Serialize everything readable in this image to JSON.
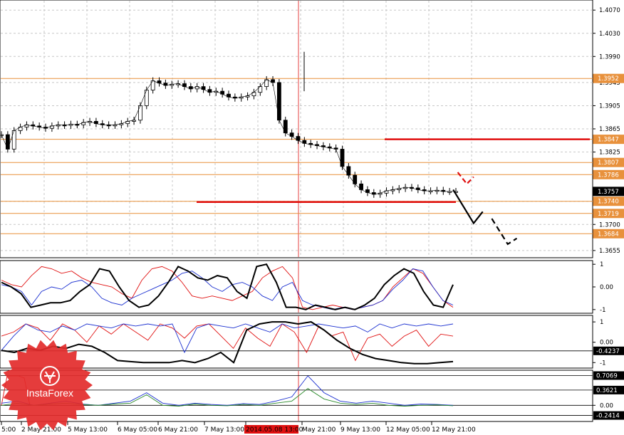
{
  "colors": {
    "level": "#e8913c",
    "red": "#e01010",
    "blue": "#1a2fd0",
    "purple": "#8a2a9a",
    "green": "#2a8a2a",
    "black": "#000000",
    "grid": "#c8c8c8",
    "current_tag": "#000000",
    "brand": "#e32b2b"
  },
  "brand": {
    "name": "InstaForex",
    "icon": "instaforex-logo-icon"
  },
  "chart_data": [
    {
      "type": "candlestick",
      "panel": "price",
      "ylim": [
        1.3645,
        1.4085
      ],
      "y_ticks": [
        "1.4070",
        "1.4030",
        "1.3990",
        "1.3945",
        "1.3905",
        "1.3865",
        "1.3825",
        "1.3740",
        "1.3700",
        "1.3655"
      ],
      "levels": [
        {
          "value": 1.3952,
          "label": "1.3952"
        },
        {
          "value": 1.3847,
          "label": "1.3847"
        },
        {
          "value": 1.3807,
          "label": "1.3807"
        },
        {
          "value": 1.3786,
          "label": "1.3786"
        },
        {
          "value": 1.374,
          "label": "1.3740"
        },
        {
          "value": 1.3719,
          "label": "1.3719"
        },
        {
          "value": 1.3684,
          "label": "1.3684"
        }
      ],
      "current_price": {
        "value": 1.3757,
        "label": "1.3757"
      },
      "marked_time": "2014.05.08 13:00",
      "x_labels": [
        "5:00",
        "2 May 21:00",
        "5 May 13:00",
        "6 May 05:00",
        "6 May 21:00",
        "7 May 13:00",
        "2014.05.08 13:00",
        "May 21:00",
        "9 May 13:00",
        "12 May 05:00",
        "12 May 21:00"
      ],
      "x_label_positions": [
        0,
        1,
        2,
        3,
        4,
        5,
        6,
        7,
        8,
        9,
        10
      ],
      "resistance_line": {
        "value": 1.3847,
        "from_index": 3,
        "to_index": 14
      },
      "support_line": {
        "value": 1.374,
        "from_index": 4,
        "to_index": 9
      },
      "close_path": [
        1.3855,
        1.383,
        1.3862,
        1.3868,
        1.3872,
        1.387,
        1.3868,
        1.3866,
        1.387,
        1.3872,
        1.3871,
        1.3873,
        1.3872,
        1.3876,
        1.3878,
        1.3874,
        1.3872,
        1.3871,
        1.3872,
        1.3874,
        1.3878,
        1.388,
        1.3905,
        1.3932,
        1.3948,
        1.3944,
        1.394,
        1.3942,
        1.3943,
        1.3938,
        1.3934,
        1.3938,
        1.3933,
        1.3928,
        1.393,
        1.3925,
        1.392,
        1.3918,
        1.392,
        1.3922,
        1.3928,
        1.3938,
        1.395,
        1.3945,
        1.388,
        1.3858,
        1.3852,
        1.3845,
        1.384,
        1.3838,
        1.3836,
        1.3834,
        1.3832,
        1.383,
        1.38,
        1.3785,
        1.377,
        1.376,
        1.3755,
        1.3752,
        1.3754,
        1.3758,
        1.376,
        1.3762,
        1.3764,
        1.3763,
        1.376,
        1.3758,
        1.3758,
        1.3759,
        1.3757,
        1.3757,
        1.3757
      ],
      "forecast": {
        "black_path": [
          [
            0.9,
            1.376
          ],
          [
            0.945,
            1.3702
          ],
          [
            0.965,
            1.3722
          ]
        ],
        "black_dashed": [
          [
            0.985,
            1.371
          ],
          [
            1.02,
            1.3666
          ],
          [
            1.04,
            1.3676
          ]
        ],
        "red_dashed": [
          [
            0.91,
            1.379
          ],
          [
            0.93,
            1.377
          ],
          [
            0.945,
            1.3782
          ]
        ]
      }
    },
    {
      "type": "line",
      "panel": "oscillator_1",
      "ylim": [
        -1.1,
        1.1
      ],
      "y_ticks": [
        "1",
        "0.00",
        "-1"
      ],
      "series": [
        {
          "color_key": "red",
          "values": [
            0.3,
            0.1,
            0.0,
            0.5,
            0.9,
            0.8,
            0.6,
            0.7,
            0.4,
            0.2,
            0.1,
            0.0,
            -0.3,
            -0.5,
            0.3,
            0.8,
            0.9,
            0.7,
            0.2,
            -0.4,
            -0.5,
            -0.4,
            -0.5,
            -0.6,
            -0.4,
            -0.2,
            0.4,
            0.7,
            0.9,
            0.4,
            -0.9,
            -1.0,
            -0.9,
            -0.8,
            -0.9,
            -1.0,
            -0.9,
            -0.8,
            -0.6,
            0.0,
            0.4,
            0.8,
            0.6,
            0.0,
            -0.6,
            -0.9
          ]
        },
        {
          "color_key": "blue",
          "values": [
            0.1,
            0.0,
            -0.2,
            -0.8,
            -0.2,
            0.0,
            -0.1,
            0.2,
            0.3,
            0.0,
            -0.5,
            -0.7,
            -0.8,
            -0.5,
            -0.3,
            -0.1,
            0.1,
            0.3,
            0.6,
            0.7,
            0.4,
            0.0,
            -0.2,
            0.1,
            0.2,
            0.0,
            -0.4,
            -0.6,
            0.0,
            0.2,
            -0.6,
            -0.8,
            -0.9,
            -1.0,
            -0.9,
            -1.0,
            -0.9,
            -0.8,
            -0.6,
            -0.1,
            0.3,
            0.8,
            0.7,
            0.0,
            -0.6,
            -0.8
          ]
        },
        {
          "color_key": "black",
          "values": [
            0.2,
            0.0,
            -0.3,
            -0.9,
            -0.8,
            -0.7,
            -0.7,
            -0.6,
            -0.2,
            0.1,
            0.8,
            0.7,
            0.0,
            -0.6,
            -0.9,
            -0.8,
            -0.4,
            0.2,
            0.9,
            0.7,
            0.4,
            0.3,
            0.5,
            0.4,
            -0.2,
            -0.5,
            0.9,
            1.0,
            0.2,
            -0.9,
            -0.9,
            -1.0,
            -0.8,
            -0.9,
            -1.0,
            -0.9,
            -1.0,
            -0.8,
            -0.5,
            0.1,
            0.5,
            0.8,
            0.6,
            -0.2,
            -0.8,
            -0.9,
            0.1
          ]
        }
      ]
    },
    {
      "type": "line",
      "panel": "oscillator_2",
      "ylim": [
        -1.2,
        1.25
      ],
      "y_ticks": [
        "1",
        "0.00",
        "-1"
      ],
      "levels": [
        {
          "value": -0.4237,
          "label": "-0.4237"
        }
      ],
      "series": [
        {
          "color_key": "red",
          "values": [
            0.3,
            0.5,
            0.9,
            0.7,
            0.1,
            0.9,
            0.6,
            0.0,
            0.8,
            0.4,
            0.9,
            0.5,
            0.1,
            0.9,
            0.7,
            0.2,
            0.8,
            0.9,
            0.3,
            -0.3,
            0.7,
            0.2,
            -0.2,
            0.9,
            0.5,
            -0.5,
            0.8,
            0.3,
            0.5,
            -0.9,
            0.2,
            0.4,
            -0.2,
            0.3,
            0.6,
            -0.2,
            0.4,
            0.3
          ]
        },
        {
          "color_key": "blue",
          "values": [
            -0.4,
            0.3,
            0.9,
            0.6,
            0.5,
            0.8,
            0.6,
            0.9,
            0.8,
            0.7,
            0.9,
            0.8,
            0.9,
            0.8,
            0.9,
            -0.5,
            0.7,
            0.9,
            0.8,
            0.7,
            0.9,
            0.7,
            0.5,
            0.9,
            0.7,
            0.8,
            0.9,
            0.8,
            0.7,
            0.8,
            0.5,
            0.9,
            0.7,
            0.9,
            0.8,
            0.9,
            0.8,
            0.9
          ]
        },
        {
          "color_key": "black",
          "values": [
            -0.4,
            -0.5,
            -0.3,
            -0.4,
            -0.2,
            -0.3,
            -0.1,
            -0.2,
            -0.5,
            -0.9,
            -0.95,
            -1.0,
            -1.0,
            -1.0,
            -0.9,
            -1.0,
            -0.8,
            -0.5,
            -1.0,
            0.6,
            0.9,
            1.0,
            1.0,
            0.9,
            1.0,
            0.6,
            0.1,
            -0.3,
            -0.6,
            -0.8,
            -0.9,
            -1.0,
            -1.05,
            -1.05,
            -1.0,
            -0.95
          ]
        }
      ]
    },
    {
      "type": "line",
      "panel": "oscillator_3",
      "ylim": [
        -0.35,
        0.8
      ],
      "y_ticks": [
        "0.00"
      ],
      "levels": [
        {
          "value": 0.7069,
          "label": "0.7069"
        },
        {
          "value": 0.3621,
          "label": "0.3621"
        },
        {
          "value": 0.0,
          "label": "0.00"
        },
        {
          "value": -0.2414,
          "label": "-0.2414"
        }
      ],
      "series": [
        {
          "color_key": "red",
          "values": [
            0.0,
            0.7,
            0.7,
            0.7,
            0.65,
            0.0
          ]
        },
        {
          "color_key": "blue",
          "values": [
            0.05,
            0.1,
            0.0,
            0.05,
            0.1,
            0.03,
            0.0,
            0.05,
            0.1,
            0.3,
            0.05,
            0.0,
            0.05,
            0.02,
            0.0,
            0.04,
            0.02,
            0.1,
            0.2,
            0.7,
            0.3,
            0.1,
            0.05,
            0.1,
            0.05,
            0.0,
            0.03,
            0.02,
            0.0
          ]
        },
        {
          "color_key": "green",
          "values": [
            0.0,
            0.05,
            0.0,
            0.03,
            0.05,
            0.02,
            0.0,
            0.03,
            0.05,
            0.25,
            0.0,
            -0.02,
            0.03,
            0.0,
            -0.01,
            0.02,
            0.0,
            0.05,
            0.1,
            0.4,
            0.15,
            0.05,
            0.02,
            0.05,
            0.0,
            -0.02,
            0.0,
            0.01,
            -0.01
          ]
        }
      ]
    }
  ]
}
